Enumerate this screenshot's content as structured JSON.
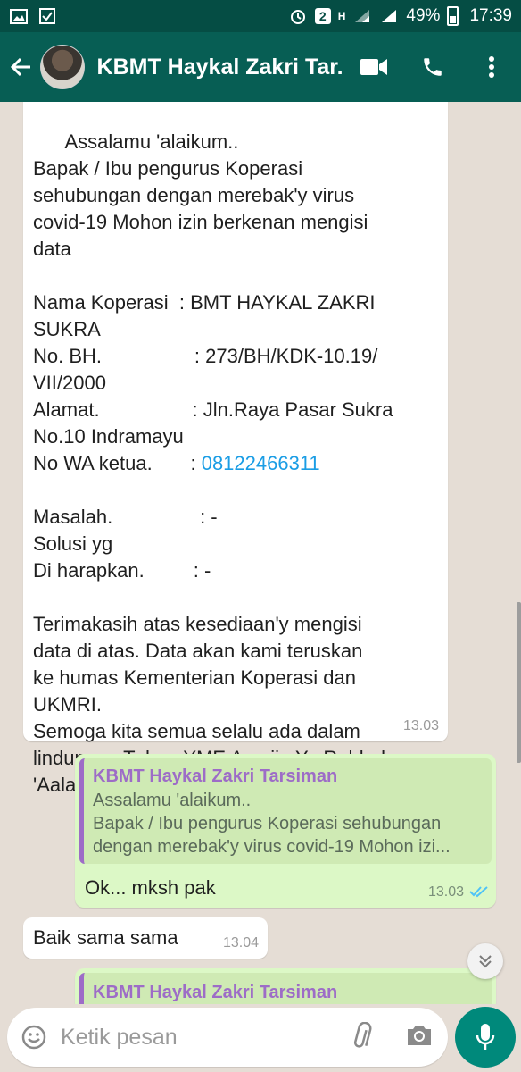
{
  "status_bar": {
    "left_icons": [
      "image-icon",
      "checkbox-icon"
    ],
    "notification_count": "2",
    "network": "H",
    "battery": "49%",
    "time": "17:39"
  },
  "header": {
    "title": "KBMT Haykal Zakri Tar..."
  },
  "messages": {
    "m1": {
      "text": "Assalamu 'alaikum..\nBapak / Ibu pengurus Koperasi\nsehubungan dengan merebak'y virus\ncovid-19 Mohon izin berkenan mengisi\ndata\n\nNama Koperasi  : BMT HAYKAL ZAKRI\nSUKRA\nNo. BH.                 : 273/BH/KDK-10.19/\nVII/2000\nAlamat.                 : Jln.Raya Pasar Sukra\nNo.10 Indramayu\nNo WA ketua.",
      "phone_prefix": "       : ",
      "phone": "08122466311",
      "text_after": "Masalah.                : -\nSolusi yg\nDi harapkan.         : -\n\nTerimakasih atas kesediaan'y mengisi\ndata di atas. Data akan kami teruskan\nke humas Kementerian Koperasi dan\nUKMRI.\nSemoga kita semua selalu ada dalam\nlindungan Tuhan YME Aamiin Ya Robbal\n'Aalamiin..",
      "time": "13.03"
    },
    "m2": {
      "quote_author": "KBMT Haykal Zakri Tarsiman",
      "quote_text": "Assalamu 'alaikum..\nBapak / Ibu pengurus Koperasi sehubungan\ndengan merebak'y virus covid-19 Mohon izi...",
      "text": "Ok... mksh pak",
      "time": "13.03",
      "status": "read"
    },
    "m3": {
      "text": "Baik sama sama",
      "time": "13.04"
    },
    "m4": {
      "quote_author": "KBMT Haykal Zakri Tarsiman"
    }
  },
  "composer": {
    "placeholder": "Ketik pesan"
  },
  "colors": {
    "header": "#075e54",
    "status_bar": "#054d44",
    "outgoing": "#dcf8c6",
    "quote_author": "#9d6cc7",
    "link": "#1a9de5",
    "read_ticks": "#4fc3f7",
    "mic_button": "#00897b"
  }
}
